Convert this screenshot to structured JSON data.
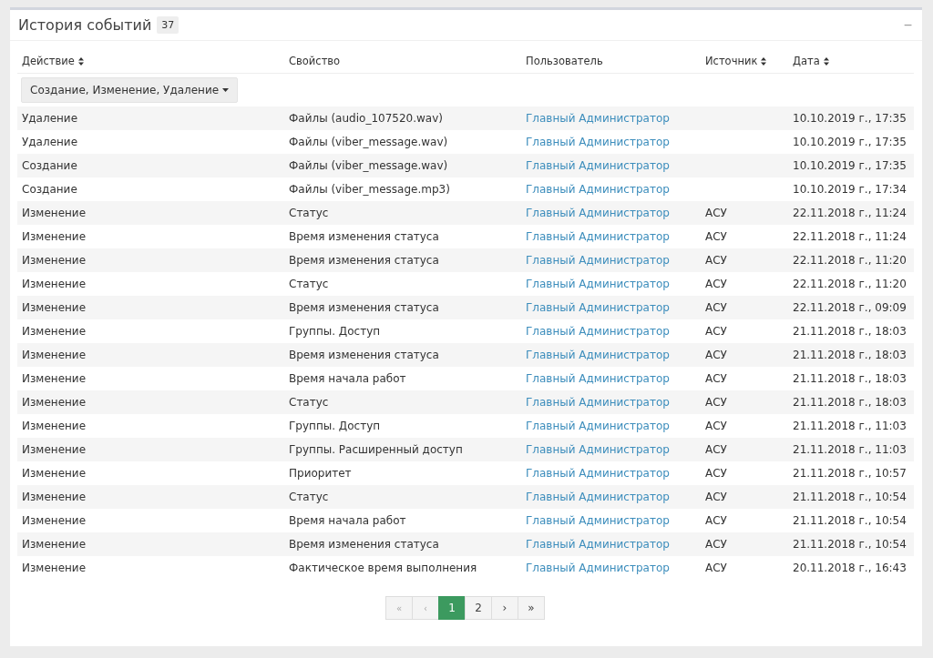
{
  "panel": {
    "title": "История событий",
    "count": "37",
    "collapse_icon": "−"
  },
  "table": {
    "columns": [
      {
        "label": "Действие",
        "sortable": true
      },
      {
        "label": "Свойство",
        "sortable": false
      },
      {
        "label": "Пользователь",
        "sortable": false
      },
      {
        "label": "Источник",
        "sortable": true
      },
      {
        "label": "Дата",
        "sortable": true
      }
    ],
    "filter": {
      "label": "Создание, Изменение, Удаление"
    },
    "rows": [
      {
        "action": "Удаление",
        "property": "Файлы (audio_107520.wav)",
        "user": "Главный Администратор",
        "date": "10.10.2019 г., 17:35"
      },
      {
        "action": "Удаление",
        "property": "Файлы (viber_message.wav)",
        "user": "Главный Администратор",
        "date": "10.10.2019 г., 17:35"
      },
      {
        "action": "Создание",
        "property": "Файлы (viber_message.wav)",
        "user": "Главный Администратор",
        "date": "10.10.2019 г., 17:35"
      },
      {
        "action": "Создание",
        "property": "Файлы (viber_message.mp3)",
        "user": "Главный Администратор",
        "date": "10.10.2019 г., 17:34"
      },
      {
        "action": "Изменение",
        "property": "Статус",
        "user": "Главный Администратор",
        "source": "АСУ",
        "date": "22.11.2018 г., 11:24"
      },
      {
        "action": "Изменение",
        "property": "Время изменения статуса",
        "user": "Главный Администратор",
        "source": "АСУ",
        "date": "22.11.2018 г., 11:24"
      },
      {
        "action": "Изменение",
        "property": "Время изменения статуса",
        "user": "Главный Администратор",
        "source": "АСУ",
        "date": "22.11.2018 г., 11:20"
      },
      {
        "action": "Изменение",
        "property": "Статус",
        "user": "Главный Администратор",
        "source": "АСУ",
        "date": "22.11.2018 г., 11:20"
      },
      {
        "action": "Изменение",
        "property": "Время изменения статуса",
        "user": "Главный Администратор",
        "source": "АСУ",
        "date": "22.11.2018 г., 09:09"
      },
      {
        "action": "Изменение",
        "property": "Группы. Доступ",
        "user": "Главный Администратор",
        "source": "АСУ",
        "date": "21.11.2018 г., 18:03"
      },
      {
        "action": "Изменение",
        "property": "Время изменения статуса",
        "user": "Главный Администратор",
        "source": "АСУ",
        "date": "21.11.2018 г., 18:03"
      },
      {
        "action": "Изменение",
        "property": "Время начала работ",
        "user": "Главный Администратор",
        "source": "АСУ",
        "date": "21.11.2018 г., 18:03"
      },
      {
        "action": "Изменение",
        "property": "Статус",
        "user": "Главный Администратор",
        "source": "АСУ",
        "date": "21.11.2018 г., 18:03"
      },
      {
        "action": "Изменение",
        "property": "Группы. Доступ",
        "user": "Главный Администратор",
        "source": "АСУ",
        "date": "21.11.2018 г., 11:03"
      },
      {
        "action": "Изменение",
        "property": "Группы. Расширенный доступ",
        "user": "Главный Администратор",
        "source": "АСУ",
        "date": "21.11.2018 г., 11:03"
      },
      {
        "action": "Изменение",
        "property": "Приоритет",
        "user": "Главный Администратор",
        "source": "АСУ",
        "date": "21.11.2018 г., 10:57"
      },
      {
        "action": "Изменение",
        "property": "Статус",
        "user": "Главный Администратор",
        "source": "АСУ",
        "date": "21.11.2018 г., 10:54"
      },
      {
        "action": "Изменение",
        "property": "Время начала работ",
        "user": "Главный Администратор",
        "source": "АСУ",
        "date": "21.11.2018 г., 10:54"
      },
      {
        "action": "Изменение",
        "property": "Время изменения статуса",
        "user": "Главный Администратор",
        "source": "АСУ",
        "date": "21.11.2018 г., 10:54"
      },
      {
        "action": "Изменение",
        "property": "Фактическое время выполнения",
        "user": "Главный Администратор",
        "source": "АСУ",
        "date": "20.11.2018 г., 16:43"
      }
    ]
  },
  "pagination": [
    {
      "label": "«",
      "selected": false,
      "disabled": true
    },
    {
      "label": "‹",
      "selected": false,
      "disabled": true
    },
    {
      "label": "1",
      "selected": true,
      "disabled": false
    },
    {
      "label": "2",
      "selected": false,
      "disabled": false
    },
    {
      "label": "›",
      "selected": false,
      "disabled": false
    },
    {
      "label": "»",
      "selected": false,
      "disabled": false
    }
  ]
}
